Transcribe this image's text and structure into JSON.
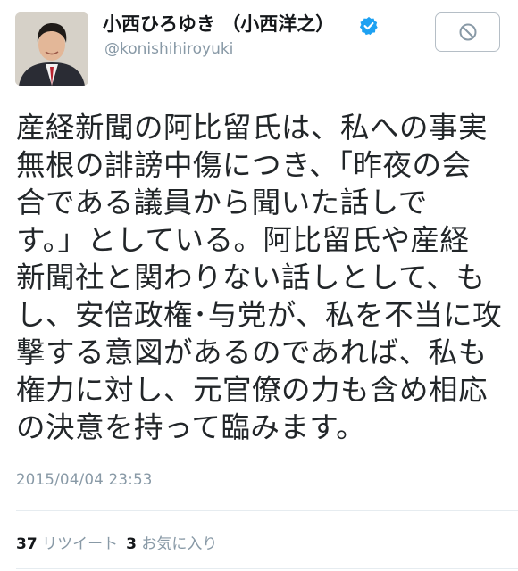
{
  "profile": {
    "display_name": "小西ひろゆき （小西洋之）",
    "handle": "@konishihiroyuki",
    "verified": true
  },
  "block_button": {
    "icon": "block-icon"
  },
  "tweet": {
    "lines": [
      "産経新聞の阿比留氏は、私への事実",
      "無根の誹謗中傷につき、「昨夜の会",
      "合である議員から聞いた話しで",
      "す。」としている。阿比留氏や産経",
      "新聞社と関わりない話しとして、も",
      "し、安倍政権･与党が、私を不当に攻",
      "撃する意図があるのであれば、私も",
      "権力に対し、元官僚の力も含め相応",
      "の決意を持って臨みます。"
    ],
    "timestamp": "2015/04/04 23:53"
  },
  "stats": {
    "retweet_count": "37",
    "retweet_label": "リツイート",
    "favorite_count": "3",
    "favorite_label": "お気に入り"
  },
  "colors": {
    "accent": "#1da1f2",
    "muted": "#8899a6",
    "text": "#222629"
  }
}
